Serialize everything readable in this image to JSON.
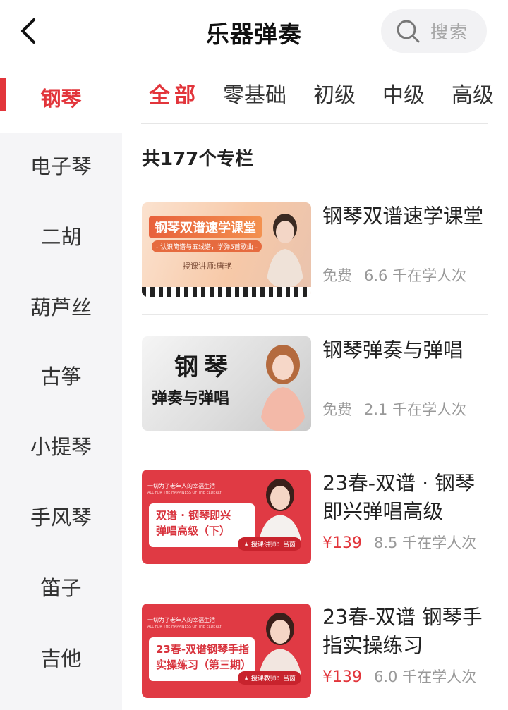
{
  "header": {
    "title": "乐器弹奏",
    "search_label": "搜索"
  },
  "sidebar": {
    "items": [
      {
        "label": "钢琴",
        "active": true
      },
      {
        "label": "电子琴"
      },
      {
        "label": "二胡"
      },
      {
        "label": "葫芦丝"
      },
      {
        "label": "古筝"
      },
      {
        "label": "小提琴"
      },
      {
        "label": "手风琴"
      },
      {
        "label": "笛子"
      },
      {
        "label": "吉他"
      }
    ]
  },
  "filters": {
    "tabs": [
      {
        "label": "全部",
        "active": true
      },
      {
        "label": "零基础"
      },
      {
        "label": "初级"
      },
      {
        "label": "中级"
      },
      {
        "label": "高级"
      }
    ]
  },
  "list": {
    "count_text": "共177个专栏",
    "courses": [
      {
        "title": "钢琴双谱速学课堂",
        "price": "免费",
        "learners": "6.6 千在学人次",
        "thumb": {
          "banner": "钢琴双谱速学课堂",
          "subtitle": "- 认识简谱与五线谱，学弹5首歌曲 -",
          "teacher": "授课讲师:唐艳"
        }
      },
      {
        "title": "钢琴弹奏与弹唱",
        "price": "免费",
        "learners": "2.1 千在学人次",
        "thumb": {
          "line1": "钢琴",
          "line2": "弹奏与弹唱"
        }
      },
      {
        "title": "23春-双谱 · 钢琴即兴弹唱高级",
        "price": "¥139",
        "learners": "8.5 千在学人次",
        "thumb": {
          "slogan": "一切为了老年人的幸福生活",
          "slogan_en": "ALL FOR THE HAPPINESS OF THE ELDERLY",
          "line1": "双谱 · 钢琴即兴",
          "line2": "弹唱高级（下）",
          "teacher": "★ 授课讲师：吕茵"
        }
      },
      {
        "title": "23春-双谱 钢琴手指实操练习",
        "price": "¥139",
        "learners": "6.0 千在学人次",
        "thumb": {
          "slogan": "一切为了老年人的幸福生活",
          "slogan_en": "ALL FOR THE HAPPINESS OF THE ELDERLY",
          "line1": "23春-双谱钢琴手指",
          "line2": "实操练习（第三期）",
          "teacher": "★ 授课教师：吕茵"
        }
      }
    ]
  },
  "colors": {
    "accent": "#e2353b",
    "sidebar_bg": "#f5f5f7",
    "muted_text": "#999999"
  }
}
